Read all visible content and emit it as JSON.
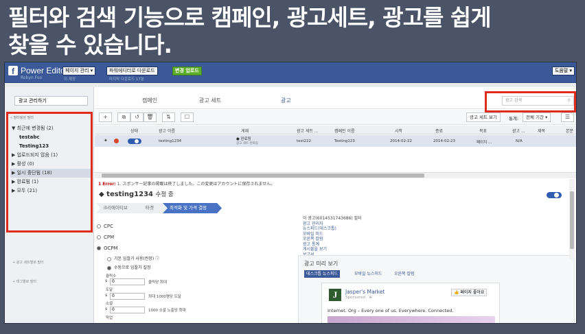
{
  "slide": {
    "line1": "필터와 검색 기능으로 캠페인, 광고세트, 광고를 쉽게",
    "line2": "찾을 수 있습니다."
  },
  "topbar": {
    "logo": "f",
    "app": "Power Editor",
    "user": "Robyn Foo",
    "btn_page": "페이지 관리 ▾",
    "btn_download": "파워에디터로 다운로드",
    "btn_upload": "변경 업로드",
    "note_account": "이 계정",
    "note_last": "마지막 다운로드 17분",
    "help": "도움말 ▾"
  },
  "sidebar": {
    "account_select": "광고 관리하기",
    "filter_label": "« 필터링된 필터",
    "items": [
      {
        "label": "▼ 최근에 변경됨 (2)",
        "cls": ""
      },
      {
        "label": "testabc",
        "cls": "sub"
      },
      {
        "label": "Testing123",
        "cls": "sub"
      },
      {
        "label": "▶ 업로드되지 않음 (1)",
        "cls": ""
      },
      {
        "label": "▶ 활성 (0)",
        "cls": ""
      },
      {
        "label": "▶ 일시 중단됨 (18)",
        "cls": "sel"
      },
      {
        "label": "▶ 완료됨 (1)",
        "cls": ""
      },
      {
        "label": "▶ 모두 (21)",
        "cls": ""
      }
    ],
    "link1": "+ 광고 세트별로 필터",
    "link2": "+ 태그별로 필터"
  },
  "tabs": {
    "campaign": "캠페인",
    "adset": "광고 세트",
    "ad": "광고"
  },
  "search": {
    "placeholder": "광고 검색"
  },
  "toolbar": {
    "i_add": "+",
    "i_dup": "⧉",
    "i_undo": "↺",
    "i_del": "🗑",
    "i_tag": "⇅",
    "i_preview": "☐",
    "adset_view": "광고 세트 보기",
    "stats": "통계:",
    "period": "전체 기간 ▾",
    "columns": "☰"
  },
  "table": {
    "h_status": "상태",
    "h_adname": "광고 이름",
    "h_review": "게재",
    "h_adset": "광고 세트 ...",
    "h_campaign": "캠페인 이름",
    "h_start": "시작",
    "h_end": "종료",
    "h_goal": "목표",
    "h_adv": "광고 ...",
    "h_title": "제목",
    "h_body": "본문",
    "row": {
      "name": "testing1234",
      "review": "● 완료됨",
      "review2": "광고 세트 완료됨",
      "adset": "test222",
      "campaign": "Testing123",
      "start": "2014-02-22",
      "end": "2014-02-23",
      "goal": "페이지 ...",
      "adv": "N/A"
    }
  },
  "error": {
    "label": "1 Error:",
    "text": "1. スポンサー記事の掲載は終了しました。この変更はアカウントに保存されません。"
  },
  "editor": {
    "title": "testing1234",
    "suffix": "수정 중",
    "crumb1": "크리에이티브",
    "crumb2": "타겟",
    "crumb3": "최적화 및 가격 결정",
    "cpc": "CPC",
    "cpm": "CPM",
    "ocpm": "OCPM",
    "opt_basic": "기본 입찰가 사용(권장)",
    "opt_manual": "수동으로 입찰가 설정",
    "f1": "클릭수",
    "f1v": "0",
    "f1n": "클릭당 최대",
    "f2": "도달",
    "f2v": "0",
    "f2n": "최대 1000명당 도달",
    "f3": "소셜",
    "f3v": "0",
    "f3n": "1000 소셜 노출당 최대",
    "f4": "작업",
    "dollar": "$"
  },
  "links": {
    "hdr": "이 광고(6014531743686) 필터",
    "l1": "광고 관리자",
    "l2": "뉴스피드(데스크톱)",
    "l3": "모바일 피드",
    "l4": "오른쪽 칼럼",
    "l5": "광고 통계",
    "l6": "게시물을 보기",
    "l7": "보고서"
  },
  "preview": {
    "title": "광고 미리 보기",
    "tab1": "데스크톱 뉴스피드",
    "tab2": "모바일 뉴스피드",
    "tab3": "오른쪽 칼럼",
    "card_logo": "J",
    "card_name": "Jasper's Market",
    "card_spon": "Sponsored · ⊕",
    "card_like": "👍 페이지 좋아요",
    "card_text": "Internet. Org – Every one of us. Everywhere. Connected."
  }
}
